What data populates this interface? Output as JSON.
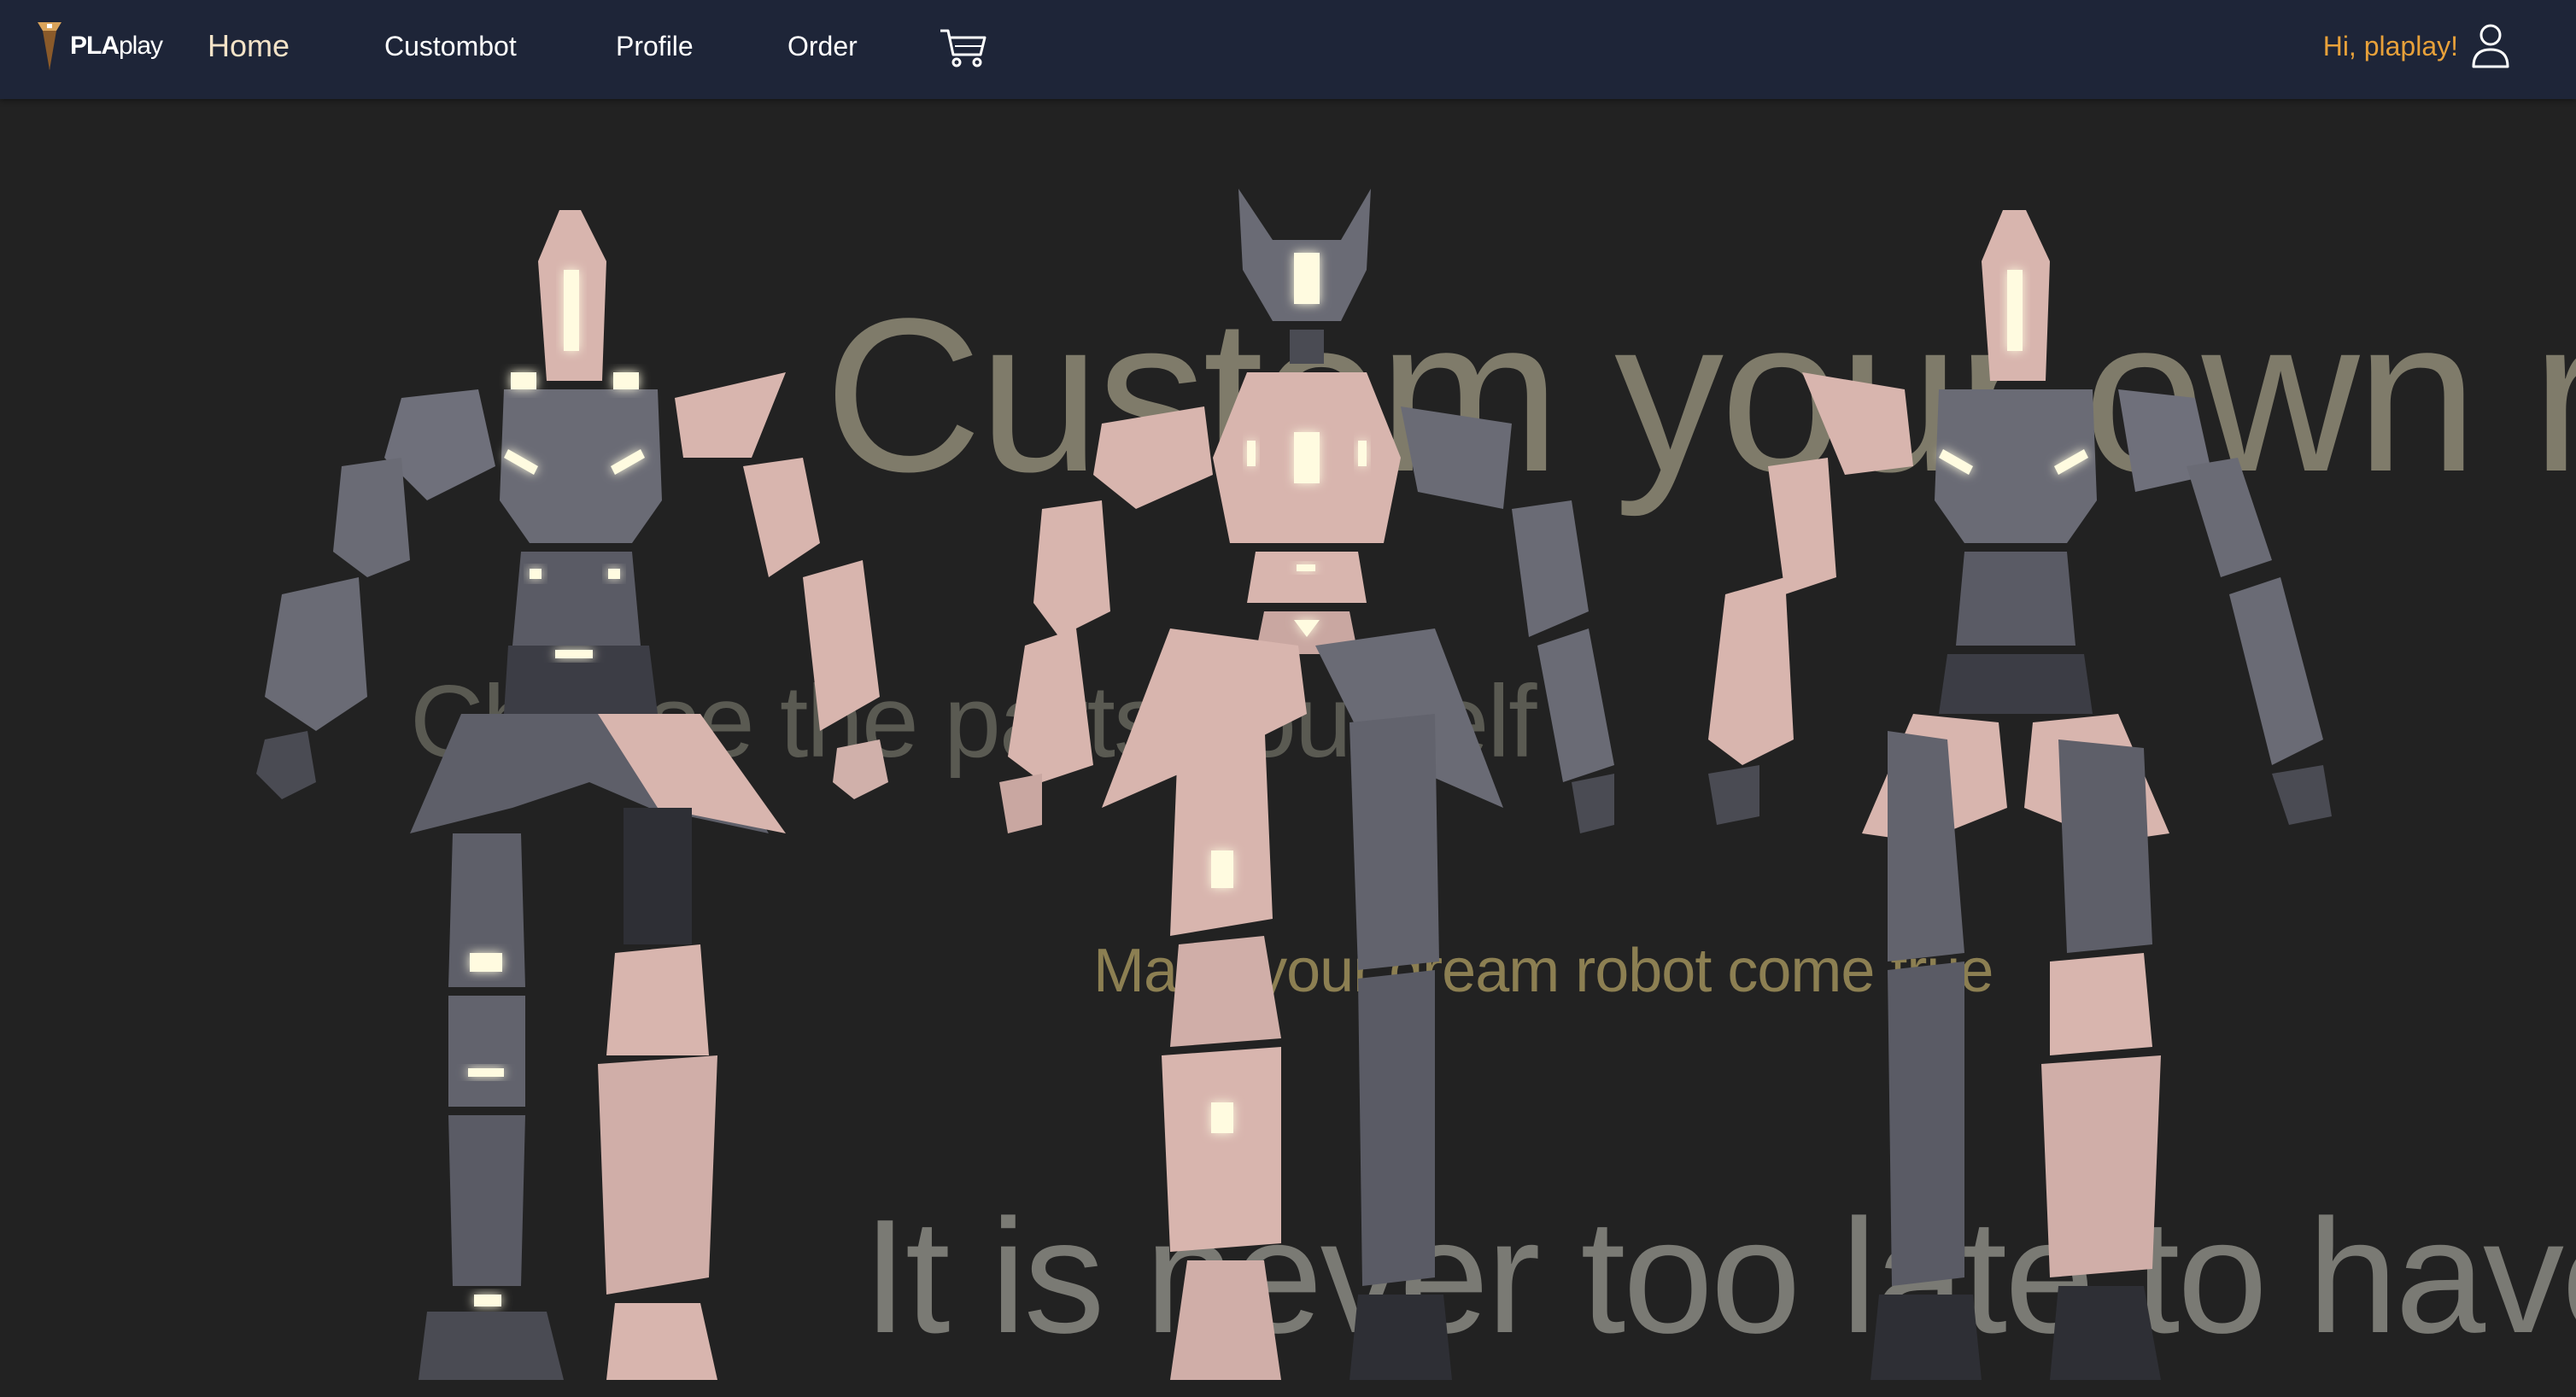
{
  "nav": {
    "logo_text_bold": "PLA",
    "logo_text_light": "play",
    "items": [
      {
        "label": "Home"
      },
      {
        "label": "Custombot"
      },
      {
        "label": "Profile"
      },
      {
        "label": "Order"
      }
    ],
    "cart_icon": "shopping-cart-icon",
    "greeting": "Hi, plaplay!",
    "user_icon": "user-icon"
  },
  "hero": {
    "headline": "Custom your own robot",
    "subheadline": "Choose the parts yourself",
    "tagline": "Make your dream robot come true",
    "footer_line": "It is never too late to have fun"
  },
  "colors": {
    "navbar_bg": "#1e2538",
    "page_bg": "#222222",
    "greeting": "#e8a13a",
    "home_active": "#f4e3c8"
  }
}
